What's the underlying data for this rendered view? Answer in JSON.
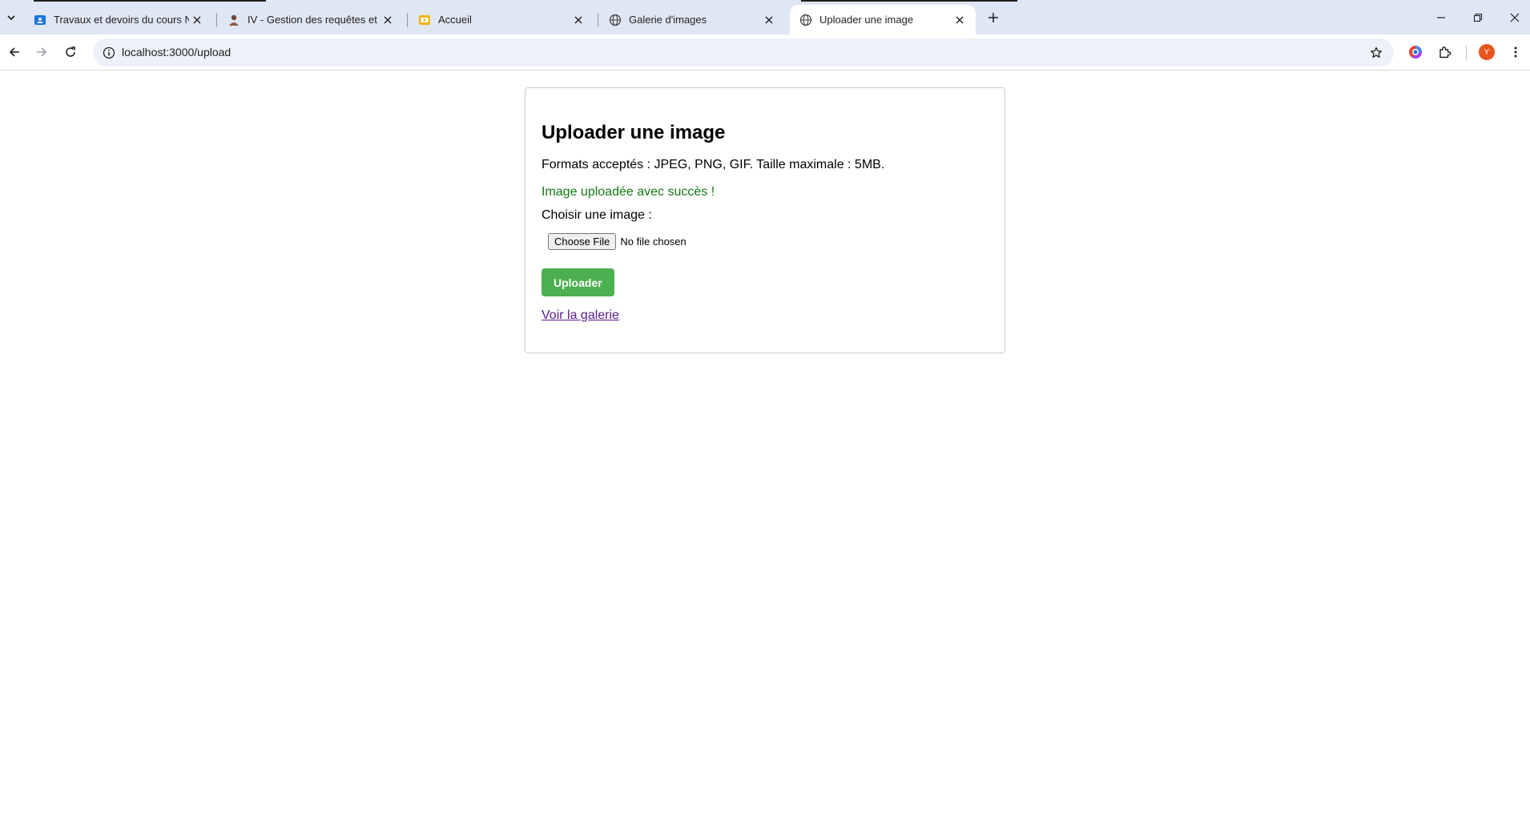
{
  "browser": {
    "tabs": [
      {
        "title": "Travaux et devoirs du cours Nor",
        "favicon": "classroom-icon",
        "active": false
      },
      {
        "title": "IV - Gestion des requêtes et rép",
        "favicon": "profile-photo-icon",
        "active": false
      },
      {
        "title": "Accueil",
        "favicon": "slides-icon",
        "active": false
      },
      {
        "title": "Galerie d'images",
        "favicon": "globe-icon",
        "active": false
      },
      {
        "title": "Uploader une image",
        "favicon": "globe-icon",
        "active": true
      }
    ],
    "url": "localhost:3000/upload",
    "profile_initial": "Y",
    "accent_color": "#e8541e"
  },
  "page": {
    "heading": "Uploader une image",
    "formats_text": "Formats acceptés : JPEG, PNG, GIF. Taille maximale : 5MB.",
    "success_message": "Image uploadée avec succès !",
    "choose_label": "Choisir une image :",
    "file_button_label": "Choose File",
    "file_status": "No file chosen",
    "upload_button_label": "Uploader",
    "gallery_link": "Voir la galerie",
    "colors": {
      "upload_button": "#4caf50",
      "success_text": "#137a13",
      "link_visited": "#551a8b"
    }
  }
}
